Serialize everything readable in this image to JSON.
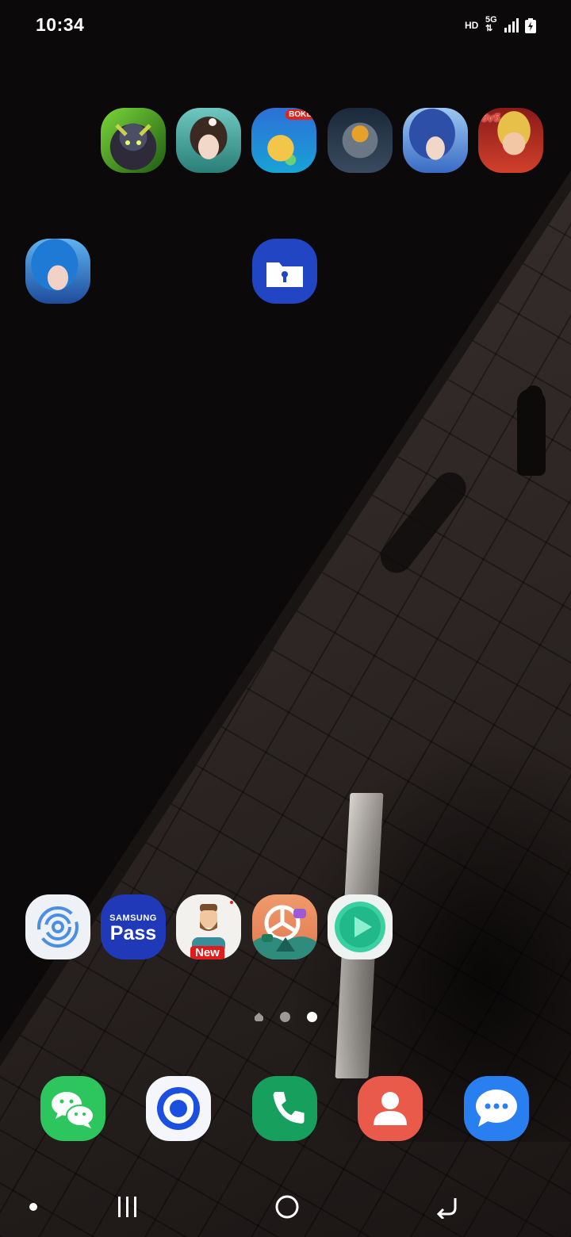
{
  "status_bar": {
    "time": "10:34",
    "network_label": "HD",
    "network_type": "5G",
    "signal_icon": "signal-bars-icon",
    "battery_icon": "battery-charging-icon"
  },
  "home_screen": {
    "top_row_apps": [
      {
        "icon": "green-horned-elf-game-icon"
      },
      {
        "icon": "anime-girl-game-icon"
      },
      {
        "icon": "planet-cartoon-game-icon",
        "badge_text": "BOKE"
      },
      {
        "icon": "astronaut-robot-game-icon"
      },
      {
        "icon": "blue-haired-hero-game-icon"
      },
      {
        "icon": "hero-5v5-game-icon",
        "badge_text": "5v5"
      }
    ],
    "second_row_apps": [
      {
        "icon": "blue-haired-girl-game-icon"
      },
      {
        "icon": "secure-folder-icon"
      }
    ],
    "bottom_row_apps": [
      {
        "icon": "orbit-circles-icon"
      },
      {
        "icon": "samsung-pass-icon",
        "line1": "SAMSUNG",
        "line2": "Pass"
      },
      {
        "icon": "bearded-man-avatar-icon",
        "badge_text": "New"
      },
      {
        "icon": "chat-landscape-icon"
      },
      {
        "icon": "green-play-button-icon"
      }
    ],
    "page_indicator": {
      "pages": 3,
      "current": 3,
      "first_is_home": true
    }
  },
  "dock": {
    "apps": [
      {
        "icon": "wechat-icon",
        "color": "#2dc55e"
      },
      {
        "icon": "blue-ring-chat-icon",
        "color": "#1b4fe0"
      },
      {
        "icon": "phone-icon",
        "color": "#17a05d"
      },
      {
        "icon": "contacts-icon",
        "color": "#ea5a4b"
      },
      {
        "icon": "messages-icon",
        "color": "#2a7ff0"
      }
    ]
  },
  "navigation_bar": {
    "buttons": [
      "dot-icon",
      "recent-apps-icon",
      "home-icon",
      "back-icon"
    ]
  }
}
